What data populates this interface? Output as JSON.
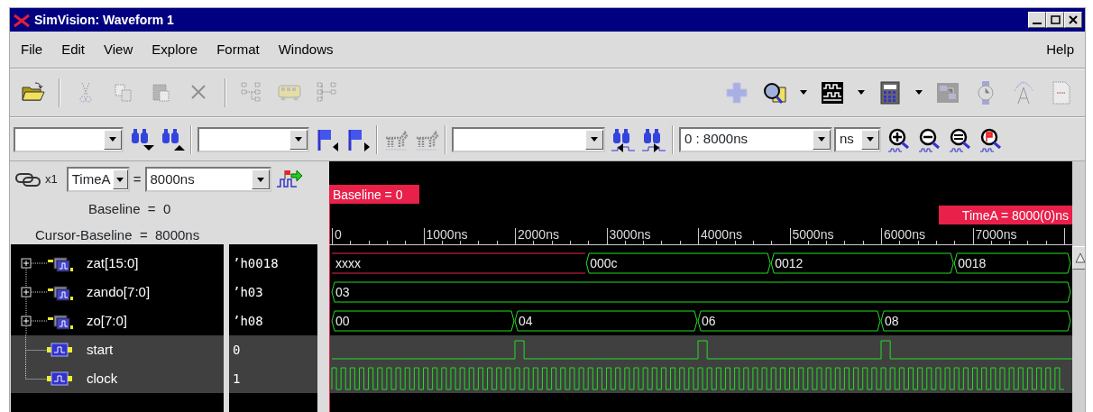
{
  "window": {
    "title": "SimVision: Waveform 1"
  },
  "menu": [
    {
      "label": "File"
    },
    {
      "label": "Edit"
    },
    {
      "label": "View"
    },
    {
      "label": "Explore"
    },
    {
      "label": "Format"
    },
    {
      "label": "Windows"
    }
  ],
  "help_menu": {
    "label": "Help"
  },
  "toolbar": [
    {
      "disabled": false
    },
    {
      "disabled": true
    },
    {
      "disabled": true
    },
    {
      "disabled": true
    },
    {
      "disabled": true
    },
    {
      "disabled": true
    },
    {
      "disabled": true
    },
    {
      "disabled": true
    },
    {
      "disabled": true
    },
    {
      "disabled": false
    },
    {
      "disabled": false
    },
    {
      "disabled": false
    },
    {
      "disabled": true
    },
    {
      "disabled": true
    },
    {
      "disabled": true
    },
    {
      "disabled": true
    }
  ],
  "search_toolbar": {
    "tools": [
      {
        "disabled": false
      },
      {
        "disabled": false
      },
      {
        "disabled": false
      },
      {
        "disabled": false
      },
      {
        "disabled": true
      },
      {
        "disabled": true
      },
      {
        "disabled": false
      },
      {
        "disabled": false
      },
      {
        "disabled": false
      },
      {
        "disabled": false
      },
      {
        "disabled": false
      },
      {
        "disabled": false
      }
    ],
    "range": "0 : 8000ns",
    "unit": "ns"
  },
  "cursor_panel": {
    "multiplier": "x1",
    "cursor": "TimeA",
    "equals": "=",
    "time": "8000ns",
    "baseline": "Baseline  =  0",
    "delta": "Cursor-Baseline  =  8000ns"
  },
  "signals": [
    {
      "name": "zat[15:0]",
      "value": "’h0018",
      "kind": "bus",
      "expanded": false,
      "selected": false,
      "segments": [
        {
          "label": "xxxx",
          "kind": "unknown"
        },
        {
          "label": "000c",
          "kind": "value"
        },
        {
          "label": "0012",
          "kind": "value"
        },
        {
          "label": "0018",
          "kind": "value"
        }
      ]
    },
    {
      "name": "zando[7:0]",
      "value": "’h03",
      "kind": "bus",
      "expanded": false,
      "selected": false,
      "segments": [
        {
          "label": "03",
          "kind": "value"
        }
      ]
    },
    {
      "name": "zo[7:0]",
      "value": "’h08",
      "kind": "bus",
      "expanded": false,
      "selected": false,
      "segments": [
        {
          "label": "00",
          "kind": "value"
        },
        {
          "label": "04",
          "kind": "value"
        },
        {
          "label": "06",
          "kind": "value"
        },
        {
          "label": "08",
          "kind": "value"
        }
      ]
    },
    {
      "name": "start",
      "value": "0",
      "kind": "pulse",
      "selected": true
    },
    {
      "name": "clock",
      "value": "1",
      "kind": "clock",
      "selected": true
    }
  ],
  "waveform": {
    "baseline_flag": "Baseline = 0",
    "cursor_flag": "TimeA = 8000(0)ns",
    "time_ticks": [
      "0",
      "1000ns",
      "2000ns",
      "3000ns",
      "4000ns",
      "5000ns",
      "6000ns",
      "7000ns"
    ]
  }
}
